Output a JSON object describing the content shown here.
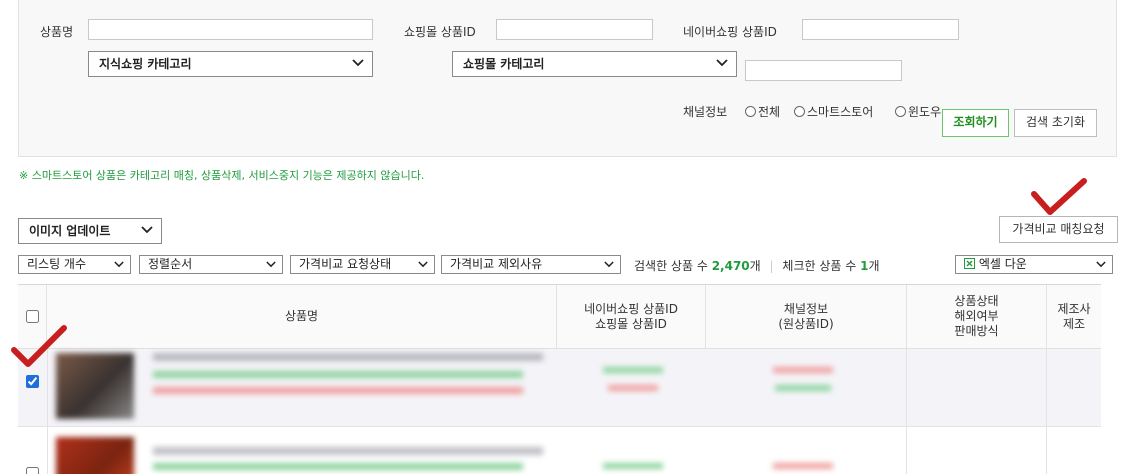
{
  "search": {
    "product_name_label": "상품명",
    "mall_product_id_label": "쇼핑몰 상품ID",
    "naver_product_id_label": "네이버쇼핑 상품ID",
    "knowledge_category": "지식쇼핑 카테고리",
    "mall_category": "쇼핑몰 카테고리",
    "channel_label": "채널정보",
    "channel_options": [
      "전체",
      "스마트스토어",
      "윈도우"
    ],
    "search_button": "조회하기",
    "reset_button": "검색 초기화"
  },
  "notice": "※ 스마트스토어 상품은 카테고리 매칭, 상품삭제, 서비스중지 기능은 제공하지 않습니다.",
  "toolbar": {
    "image_update": "이미지 업데이트",
    "price_match_request": "가격비교 매칭요청",
    "filters": [
      "리스팅 개수",
      "정렬순서",
      "가격비교 요청상태",
      "가격비교 제외사유"
    ],
    "searched_label": "검색한 상품 수",
    "searched_count": "2,470",
    "checked_label": "체크한 상품 수",
    "checked_count": "1",
    "count_unit": "개",
    "excel_download": "엑셀 다운"
  },
  "table": {
    "headers": {
      "product_name": "상품명",
      "ids_line1": "네이버쇼핑 상품ID",
      "ids_line2": "쇼핑몰 상품ID",
      "channel_line1": "채널정보",
      "channel_line2": "(원상품ID)",
      "status_line1": "상품상태",
      "status_line2": "해외여부",
      "status_line3": "판매방식",
      "maker_line1": "제조사",
      "maker_line2": "제조"
    },
    "rows": [
      {
        "checked": true
      },
      {
        "checked": false
      }
    ]
  },
  "colors": {
    "accent_green": "#1f9c3d",
    "annotation_red": "#c81e1e"
  }
}
